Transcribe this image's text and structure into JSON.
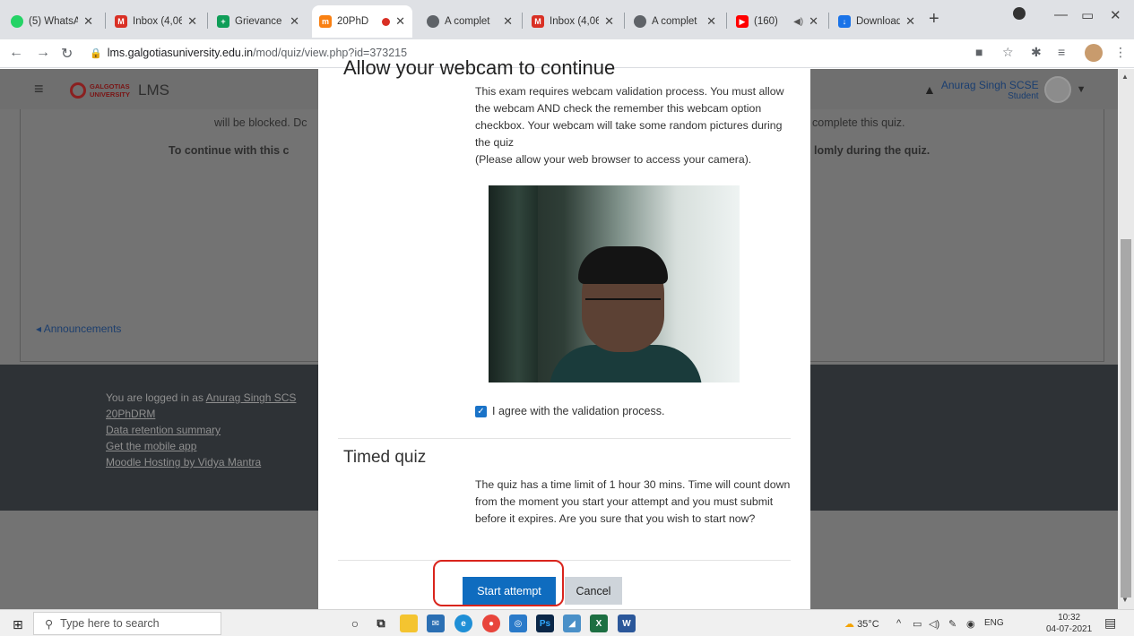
{
  "browser": {
    "tabs": [
      {
        "label": "(5) WhatsA",
        "icon": "whatsapp-icon",
        "color": "#25d366"
      },
      {
        "label": "Inbox (4,06",
        "icon": "gmail-icon",
        "color": "#d93025"
      },
      {
        "label": "Grievance",
        "icon": "sheets-icon",
        "color": "#0f9d58"
      },
      {
        "label": "20PhD",
        "icon": "moodle-icon",
        "color": "#f98012",
        "active": true
      },
      {
        "label": "A complet",
        "icon": "globe-icon",
        "color": "#5f6368"
      },
      {
        "label": "Inbox (4,06",
        "icon": "gmail-icon",
        "color": "#d93025"
      },
      {
        "label": "A complet",
        "icon": "globe-icon",
        "color": "#5f6368"
      },
      {
        "label": "(160)",
        "icon": "youtube-icon",
        "color": "#ff0000"
      },
      {
        "label": "Download",
        "icon": "download-icon",
        "color": "#1a73e8"
      }
    ],
    "url_domain": "lms.galgotiasuniversity.edu.in",
    "url_path": "/mod/quiz/view.php?id=373215"
  },
  "lms": {
    "brand": "GALGOTIAS UNIVERSITY",
    "title": "LMS",
    "user_name": "Anurag Singh SCSE",
    "user_role": "Student",
    "bg_line1_left": "will be blocked. Dc",
    "bg_line1_right": "complete this quiz.",
    "bg_line2_left": "To continue with this c",
    "bg_line2_right": "lomly during the quiz.",
    "announcements": "Announcements",
    "footer": {
      "logged_in_prefix": "You are logged in as",
      "logged_in_user": "Anurag Singh SCS",
      "course": "20PhDRM",
      "data_retention": "Data retention summary",
      "mobile_app": "Get the mobile app",
      "hosting": "Moodle Hosting by Vidya Mantra"
    }
  },
  "modal": {
    "title": "Allow your webcam to continue",
    "webcam_text": "This exam requires webcam validation process. You must allow the webcam AND check the remember this webcam option checkbox. Your webcam will take some random pictures during the quiz",
    "webcam_note": "(Please allow your web browser to access your camera).",
    "agree_label": "I agree with the validation process.",
    "timed_title": "Timed quiz",
    "timed_text": "The quiz has a time limit of 1 hour 30 mins. Time will count down from the moment you start your attempt and you must submit before it expires. Are you sure that you wish to start now?",
    "start_button": "Start attempt",
    "cancel_button": "Cancel"
  },
  "taskbar": {
    "search_placeholder": "Type here to search",
    "weather": "35°C",
    "language": "ENG",
    "time": "10:32",
    "date": "04-07-2021"
  },
  "colors": {
    "primary": "#0f6cbf",
    "highlight": "#d9241c"
  }
}
